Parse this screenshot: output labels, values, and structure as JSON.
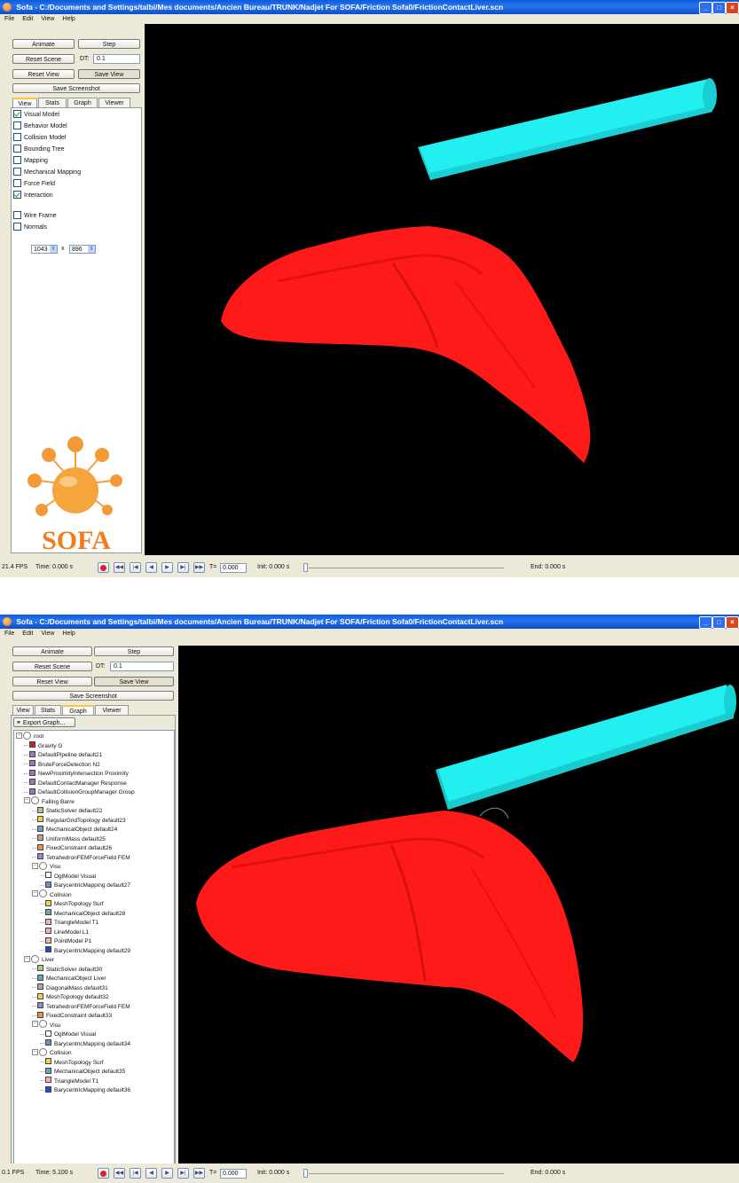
{
  "window1": {
    "title": "Sofa - C:/Documents and Settings/talbi/Mes documents/Ancien Bureau/TRUNK/Nadjet For SOFA/Friction Sofa0/FrictionContactLiver.scn",
    "menu": [
      "File",
      "Edit",
      "View",
      "Help"
    ],
    "buttons": {
      "animate": "Animate",
      "step": "Step",
      "reset_scene": "Reset Scene",
      "reset_view": "Reset View",
      "save_view": "Save View",
      "save_screenshot": "Save Screenshot"
    },
    "dt_label": "DT:",
    "dt_value": "0.1",
    "tabs": [
      "View",
      "Stats",
      "Graph",
      "Viewer"
    ],
    "active_tab": "View",
    "checkboxes": [
      {
        "label": "Visual Model",
        "checked": true
      },
      {
        "label": "Behavior Model",
        "checked": false
      },
      {
        "label": "Collision Model",
        "checked": false
      },
      {
        "label": "Bounding Tree",
        "checked": false
      },
      {
        "label": "Mapping",
        "checked": false
      },
      {
        "label": "Mechanical Mapping",
        "checked": false
      },
      {
        "label": "Force Field",
        "checked": false
      },
      {
        "label": "Interaction",
        "checked": true
      },
      {
        "label": "Wire Frame",
        "checked": false
      },
      {
        "label": "Normals",
        "checked": false
      }
    ],
    "resolution": {
      "width": "1043",
      "x": "x",
      "height": "896"
    },
    "logo_text": "SOFA",
    "status": {
      "fps": "21.4 FPS",
      "time": "Time: 0.000 s",
      "t_label": "T=",
      "t_value": "0.000",
      "init": "Init: 0.000 s",
      "end": "End: 0.000 s"
    }
  },
  "window2": {
    "title": "Sofa - C:/Documents and Settings/talbi/Mes documents/Ancien Bureau/TRUNK/Nadjet For SOFA/Friction Sofa0/FrictionContactLiver.scn",
    "menu": [
      "File",
      "Edit",
      "View",
      "Help"
    ],
    "buttons": {
      "animate": "Animate",
      "step": "Step",
      "reset_scene": "Reset Scene",
      "reset_view": "Reset View",
      "save_view": "Save View",
      "save_screenshot": "Save Screenshot",
      "export_graph": "Export Graph..."
    },
    "dt_label": "DT:",
    "dt_value": "0.1",
    "tabs": [
      "View",
      "Stats",
      "Graph",
      "Viewer"
    ],
    "active_tab": "Graph",
    "tree": [
      {
        "label": "root",
        "level": 0,
        "kind": "node"
      },
      {
        "label": "Gravity  G",
        "level": 1,
        "color": "#c0282c"
      },
      {
        "label": "DefaultPipeline  default21",
        "level": 1,
        "color": "#a074b8"
      },
      {
        "label": "BruteForceDetection  N2",
        "level": 1,
        "color": "#a074b8"
      },
      {
        "label": "NewProximityIntersection  Proximity",
        "level": 1,
        "color": "#a074b8"
      },
      {
        "label": "DefaultContactManager  Response",
        "level": 1,
        "color": "#a074b8"
      },
      {
        "label": "DefaultCollisionGroupManager  Group",
        "level": 1,
        "color": "#a074b8"
      },
      {
        "label": "Falling Barre",
        "level": 1,
        "kind": "node"
      },
      {
        "label": "StaticSolver  default22",
        "level": 2,
        "color": "#a8d070"
      },
      {
        "label": "RegularGridTopology  default23",
        "level": 2,
        "color": "#f0d050"
      },
      {
        "label": "MechanicalObject  default24",
        "level": 2,
        "color": "#68a8b0"
      },
      {
        "label": "UniformMass  default25",
        "level": 2,
        "color": "#b0a8a0"
      },
      {
        "label": "FixedConstraint  default26",
        "level": 2,
        "color": "#e89050"
      },
      {
        "label": "TetrahedronFEMForceField  FEM",
        "level": 2,
        "color": "#8890c8"
      },
      {
        "label": "Visu",
        "level": 2,
        "kind": "node"
      },
      {
        "label": "OglModel  Visual",
        "level": 3,
        "color": "#ffffff"
      },
      {
        "label": "BarycentricMapping  default27",
        "level": 3,
        "color": "#6890c8"
      },
      {
        "label": "Collision",
        "level": 2,
        "kind": "node"
      },
      {
        "label": "MeshTopology  Surf",
        "level": 3,
        "color": "#f0d050"
      },
      {
        "label": "MechanicalObject  default28",
        "level": 3,
        "color": "#68a8b0"
      },
      {
        "label": "TriangleModel  T1",
        "level": 3,
        "color": "#f0b0c0"
      },
      {
        "label": "LineModel  L1",
        "level": 3,
        "color": "#f0b0c0"
      },
      {
        "label": "PointModel  P1",
        "level": 3,
        "color": "#f0b0c0"
      },
      {
        "label": "BarycentricMapping  default29",
        "level": 3,
        "color": "#2050c0"
      },
      {
        "label": "Liver",
        "level": 1,
        "kind": "node"
      },
      {
        "label": "StaticSolver  default30",
        "level": 2,
        "color": "#a8d070"
      },
      {
        "label": "MechanicalObject  Liver",
        "level": 2,
        "color": "#68a8b0"
      },
      {
        "label": "DiagonalMass  default31",
        "level": 2,
        "color": "#b0a8a0"
      },
      {
        "label": "MeshTopology  default32",
        "level": 2,
        "color": "#f0d050"
      },
      {
        "label": "TetrahedronFEMForceField  FEM",
        "level": 2,
        "color": "#8890c8"
      },
      {
        "label": "FixedConstraint  default33",
        "level": 2,
        "color": "#e89050"
      },
      {
        "label": "Visu",
        "level": 2,
        "kind": "node"
      },
      {
        "label": "OglModel  Visual",
        "level": 3,
        "color": "#ffffff"
      },
      {
        "label": "BarycentricMapping  default34",
        "level": 3,
        "color": "#6890c8"
      },
      {
        "label": "Collision",
        "level": 2,
        "kind": "node"
      },
      {
        "label": "MeshTopology  Surf",
        "level": 3,
        "color": "#f0d050"
      },
      {
        "label": "MechanicalObject  default35",
        "level": 3,
        "color": "#68a8b0"
      },
      {
        "label": "TriangleModel  T1",
        "level": 3,
        "color": "#f0b0c0"
      },
      {
        "label": "BarycentricMapping  default36",
        "level": 3,
        "color": "#2050c0"
      }
    ],
    "status": {
      "fps": "0.1 FPS",
      "time": "Time: 5.100 s",
      "t_label": "T=",
      "t_value": "0.000",
      "init": "Init: 0.000 s",
      "end": "End: 0.000 s"
    }
  },
  "colors": {
    "liver": "#ff1a1a",
    "bar": "#22ffff",
    "viewport_bg": "#000000",
    "titlebar": "#0a5bdc"
  },
  "icons": {
    "minimize": "minimize-icon",
    "maximize": "maximize-icon",
    "close": "close-icon"
  }
}
